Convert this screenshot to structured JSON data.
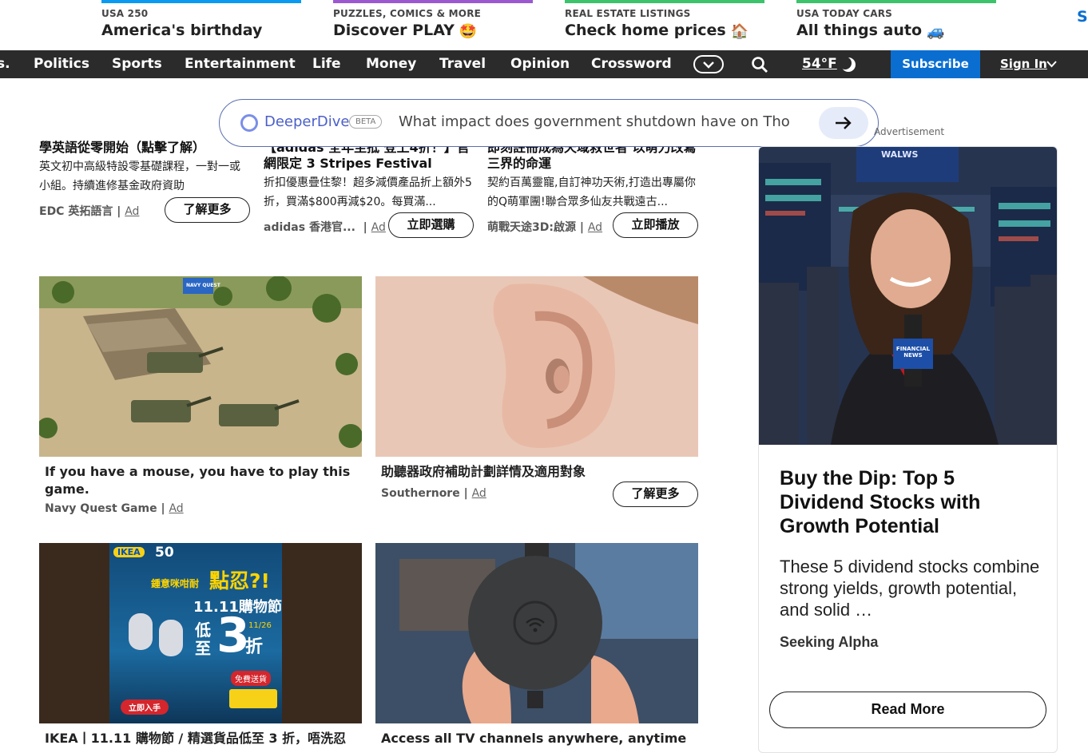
{
  "promos": [
    {
      "kicker": "USA 250",
      "headline": "America's birthday",
      "emoji": "",
      "bar_color": "#0a9bf0"
    },
    {
      "kicker": "PUZZLES, COMICS & MORE",
      "headline": "Discover PLAY",
      "emoji": "🤩",
      "bar_color": "#9b59d0"
    },
    {
      "kicker": "REAL ESTATE LISTINGS",
      "headline": "Check home prices",
      "emoji": "🏠",
      "bar_color": "#3cc36b"
    },
    {
      "kicker": "USA TODAY CARS",
      "headline": "All things auto",
      "emoji": "🚙",
      "bar_color": "#3cc36b"
    }
  ],
  "promo_edge": "S",
  "nav": {
    "items": [
      "Politics",
      "Sports",
      "Entertainment",
      "Life",
      "Money",
      "Travel",
      "Opinion",
      "Crossword"
    ],
    "cut_left": "s.",
    "weather": "54°F",
    "subscribe": "Subscribe",
    "sign_in": "Sign In",
    "colors": {
      "bar": "#2b2b2b",
      "subscribe": "#0a6ed1"
    }
  },
  "deeper_dive": {
    "brand": "DeeperDive",
    "beta": "BETA",
    "query": "What impact does government shutdown have on Tho"
  },
  "text_ads": [
    {
      "title": "學英語從零開始（點擊了解）",
      "desc": "英文初中高級特設零基礎課程，一對一或小組。持續進修基金政府資助",
      "source": "EDC 英拓語言",
      "ad": "Ad",
      "cta": "了解更多"
    },
    {
      "title": "【adidas 全年至抵 登上4折！】官網限定 3 Stripes Festival",
      "desc": "折扣優惠疊住黎！超多減價產品折上額外5折，買滿$800再減$20。每買滿...",
      "source": "adidas 香港官...",
      "ad": "Ad",
      "cta": "立即選購"
    },
    {
      "title": "即刻註冊成為天域救世者 以萌力改寫三界的命運",
      "desc": "契約百萬靈寵,自訂神功天術,打造出專屬你的Q萌軍團!聯合眾多仙友共戰遠古...",
      "source": "萌戰天途3D:啟源",
      "ad": "Ad",
      "cta": "立即播放"
    }
  ],
  "tiles": [
    {
      "title": "If you have a mouse, you have to play this game.",
      "source": "Navy Quest Game",
      "ad": "Ad",
      "cta": ""
    },
    {
      "title": "助聽器政府補助計劃詳情及適用對象",
      "source": "Southernore",
      "ad": "Ad",
      "cta": "了解更多"
    },
    {
      "title": "IKEA丨11.11 購物節 / 精選貨品低至 3 折，唔洗忍",
      "source": "",
      "ad": "",
      "cta": ""
    },
    {
      "title": "Access all TV channels anywhere, anytime",
      "source": "",
      "ad": "",
      "cta": ""
    }
  ],
  "ikea_art": {
    "logo": "IKEA",
    "badge": "50",
    "line1": "鍾意咪咁耐",
    "line2": "點忍?!",
    "line3": "11.11購物節",
    "line4a": "低",
    "line4b": "至",
    "big": "3",
    "zhe": "折",
    "dates": "11/26",
    "free": "免費送貨",
    "btn": "立即入手"
  },
  "tank_flag": "NAVY QUEST",
  "chromecast_icon": "wifi-icon",
  "advertisement_label": "Advertisement",
  "sponsored_card": {
    "title": "Buy the Dip: Top 5 Dividend Stocks with Growth Potential",
    "desc": "These 5 dividend stocks combine strong yields, growth potential, and solid …",
    "source": "Seeking Alpha",
    "cta": "Read More",
    "screen_text": "WALWS",
    "mic_text": "FINANCIAL NEWS"
  }
}
